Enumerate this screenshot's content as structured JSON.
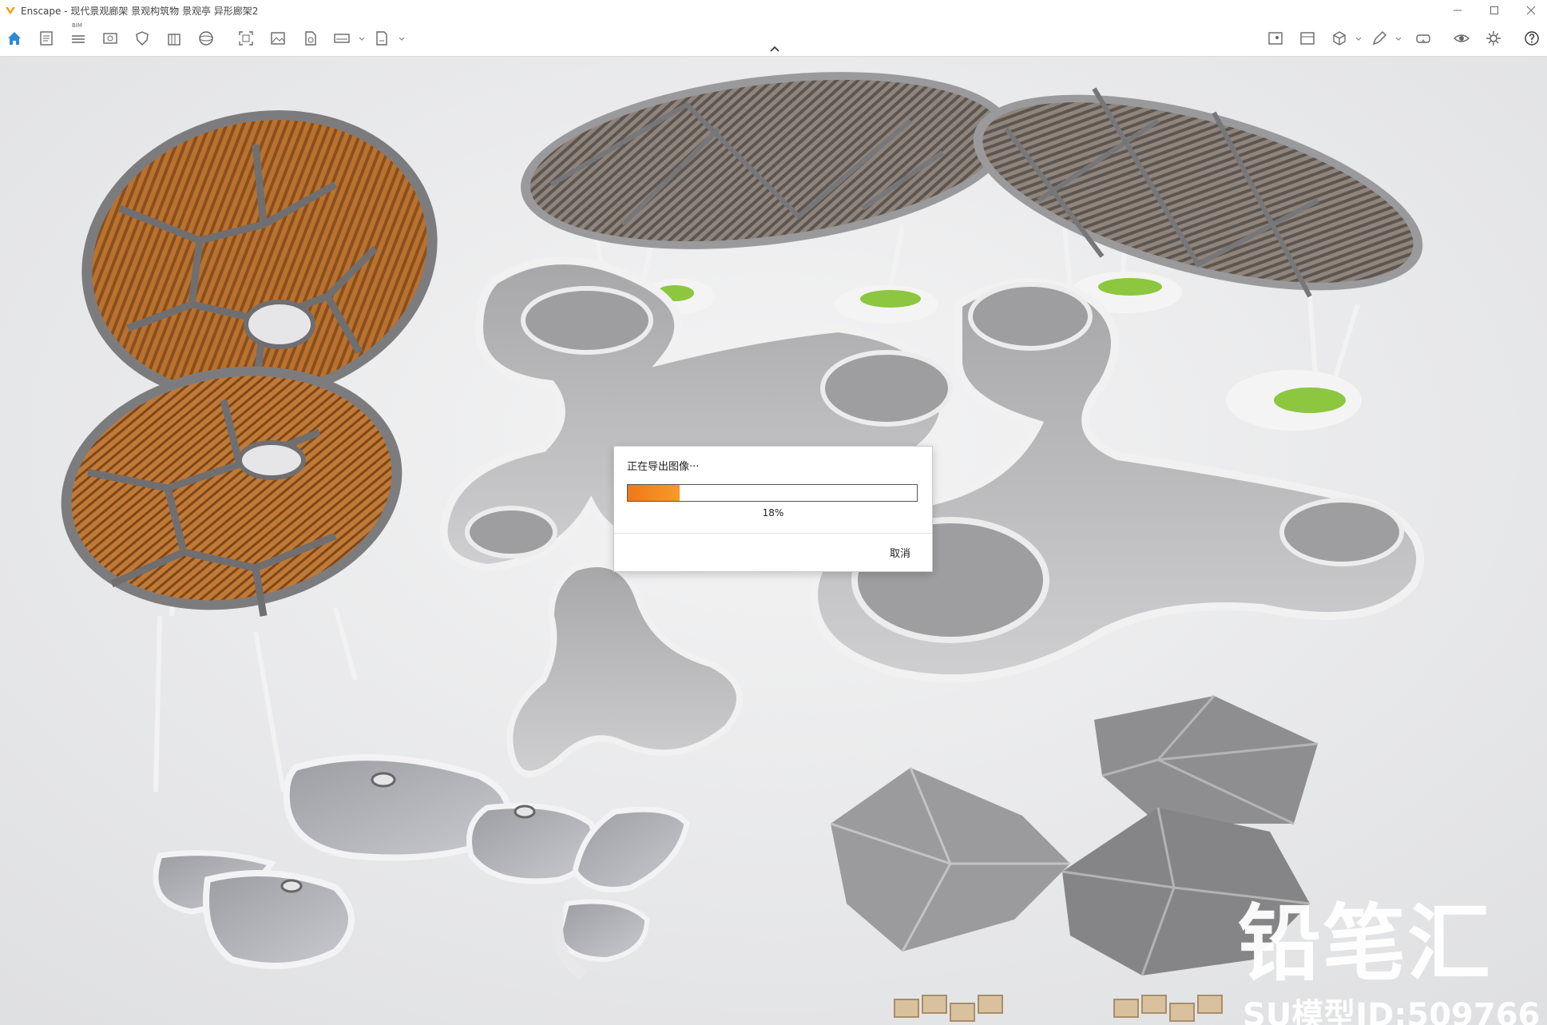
{
  "window": {
    "title": "Enscape - 现代景观廊架 景观构筑物 景观亭 异形廊架2",
    "accent": "#f0a000"
  },
  "toolbar": {
    "left_icons": [
      "home-icon",
      "document-icon",
      "bim-list-icon",
      "view-icon",
      "shield-icon",
      "building-icon",
      "sphere-icon",
      "screenshot-icon",
      "image-icon",
      "leaf-icon",
      "panorama-icon",
      "export-exe-icon"
    ],
    "bim_label": "BIM",
    "right_icons": [
      "map-icon",
      "gallery-icon",
      "cube-icon",
      "pen-icon",
      "vr-headset-icon",
      "eye-icon",
      "settings-icon",
      "help-icon"
    ]
  },
  "dialog": {
    "title": "正在导出图像···",
    "progress_fraction": 0.18,
    "progress_text": "18%",
    "cancel_label": "取消",
    "progress_color": "#f07818"
  },
  "watermark": {
    "brand": "铅笔汇",
    "model_id": "SU模型ID:509766"
  }
}
